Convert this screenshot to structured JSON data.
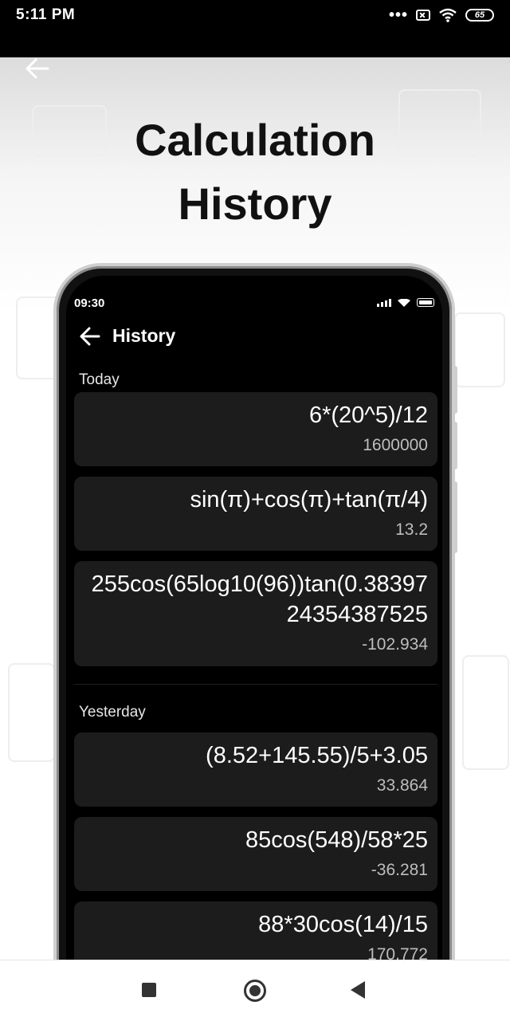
{
  "status_bar": {
    "time": "5:11 PM",
    "icons": [
      "more-dots-icon",
      "notification-box-icon",
      "wifi-icon",
      "battery-icon"
    ],
    "battery": "65"
  },
  "promo": {
    "back_icon": "arrow-left-icon",
    "headline_line1": "Calculation",
    "headline_line2": "History"
  },
  "device": {
    "time": "09:30",
    "header_title": "History",
    "sections": [
      {
        "label": "Today",
        "items": [
          {
            "expression": "6*(20^5)/12",
            "result": "1600000"
          },
          {
            "expression": "sin(π)+cos(π)+tan(π/4)",
            "result": "13.2"
          },
          {
            "expression": "255cos(65log10(96))tan(0.3839724354387525",
            "result": "-102.934"
          }
        ]
      },
      {
        "label": "Yesterday",
        "items": [
          {
            "expression": "(8.52+145.55)/5+3.05",
            "result": "33.864"
          },
          {
            "expression": "85cos(548)/58*25",
            "result": "-36.281"
          },
          {
            "expression": "88*30cos(14)/15",
            "result": "170.772"
          }
        ]
      }
    ]
  },
  "nav_bar": {
    "icons": [
      "recents-square-icon",
      "home-circle-icon",
      "back-triangle-icon"
    ]
  },
  "colors": {
    "screen_bg": "#000000",
    "card_bg": "#1c1c1c",
    "result_text": "#bdbdbd"
  }
}
